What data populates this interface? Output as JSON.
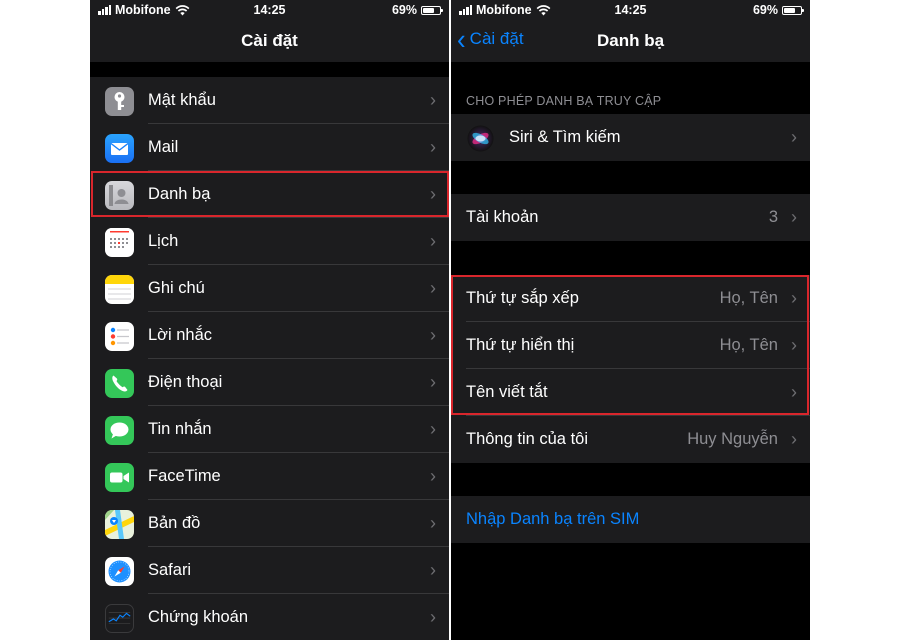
{
  "left": {
    "status": {
      "carrier": "Mobifone",
      "time": "14:25",
      "battery": "69%",
      "battery_level": 0.69
    },
    "nav_title": "Cài đặt",
    "items": [
      {
        "label": "Mật khẩu",
        "icon": "key-icon",
        "color": "#8e8e93"
      },
      {
        "label": "Mail",
        "icon": "mail-icon",
        "color": "#1a82fb"
      },
      {
        "label": "Danh bạ",
        "icon": "contacts-icon",
        "color": "#c7c7cc"
      },
      {
        "label": "Lịch",
        "icon": "calendar-icon",
        "color": "#ffffff"
      },
      {
        "label": "Ghi chú",
        "icon": "notes-icon",
        "color": "#ffd60a"
      },
      {
        "label": "Lời nhắc",
        "icon": "reminders-icon",
        "color": "#ffffff"
      },
      {
        "label": "Điện thoại",
        "icon": "phone-icon",
        "color": "#34c759"
      },
      {
        "label": "Tin nhắn",
        "icon": "messages-icon",
        "color": "#34c759"
      },
      {
        "label": "FaceTime",
        "icon": "facetime-icon",
        "color": "#34c759"
      },
      {
        "label": "Bản đồ",
        "icon": "maps-icon",
        "color": "#5ac8fa"
      },
      {
        "label": "Safari",
        "icon": "safari-icon",
        "color": "#ffffff"
      },
      {
        "label": "Chứng khoán",
        "icon": "stocks-icon",
        "color": "#1c1c1e"
      }
    ],
    "highlighted_item": "Danh bạ"
  },
  "right": {
    "status": {
      "carrier": "Mobifone",
      "time": "14:25",
      "battery": "69%",
      "battery_level": 0.69
    },
    "nav_back": "Cài đặt",
    "nav_title": "Danh bạ",
    "section_header": "CHO PHÉP DANH BẠ TRUY CẬP",
    "siri": {
      "label": "Siri & Tìm kiếm",
      "icon": "siri-icon"
    },
    "accounts": {
      "label": "Tài khoản",
      "value": "3"
    },
    "sort_order": {
      "label": "Thứ tự sắp xếp",
      "value": "Họ, Tên"
    },
    "display_order": {
      "label": "Thứ tự hiển thị",
      "value": "Họ, Tên"
    },
    "short_name": {
      "label": "Tên viết tắt"
    },
    "my_info": {
      "label": "Thông tin của tôi",
      "value": "Huy Nguyễn"
    },
    "import_sim": {
      "label": "Nhập Danh bạ trên SIM"
    }
  },
  "colors": {
    "accent": "#0a84ff",
    "highlight": "#d9262c",
    "background": "#000000",
    "cell": "#1c1c1e"
  }
}
